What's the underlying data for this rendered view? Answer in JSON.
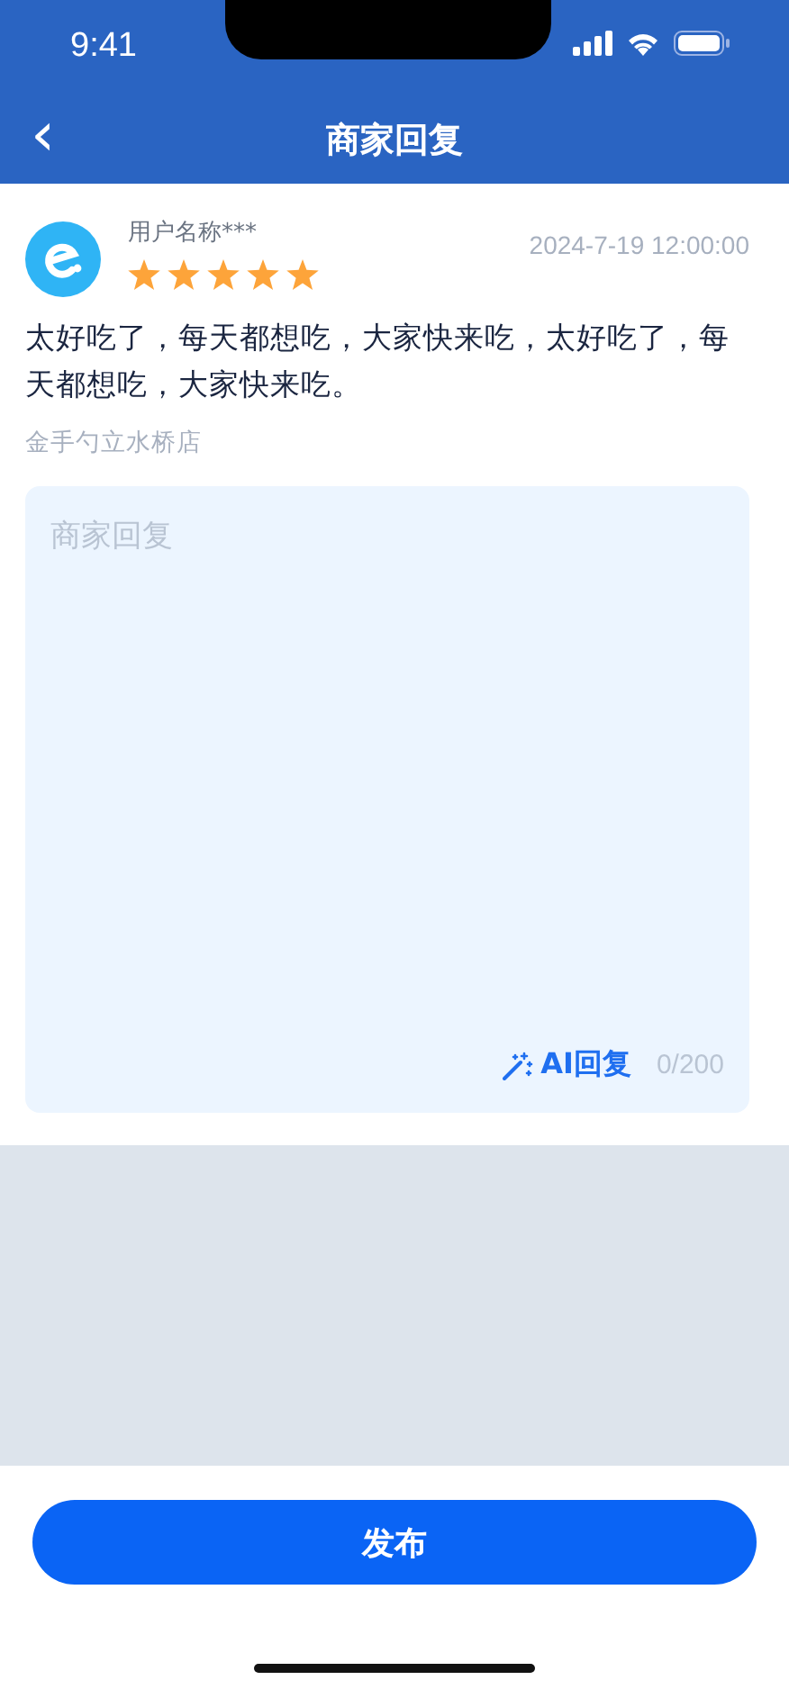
{
  "status_bar": {
    "time": "9:41"
  },
  "nav": {
    "back": "‹",
    "title": "商家回复"
  },
  "review": {
    "user": "用户名称***",
    "stars": 5,
    "time": "2024-7-19 12:00:00",
    "content": "太好吃了，每天都想吃，大家快来吃，太好吃了，每天都想吃，大家快来吃。",
    "store": "金手勺立水桥店"
  },
  "reply": {
    "placeholder": "商家回复",
    "ai_button": "AI回复",
    "counter": "0/200"
  },
  "publish_button": "发布"
}
